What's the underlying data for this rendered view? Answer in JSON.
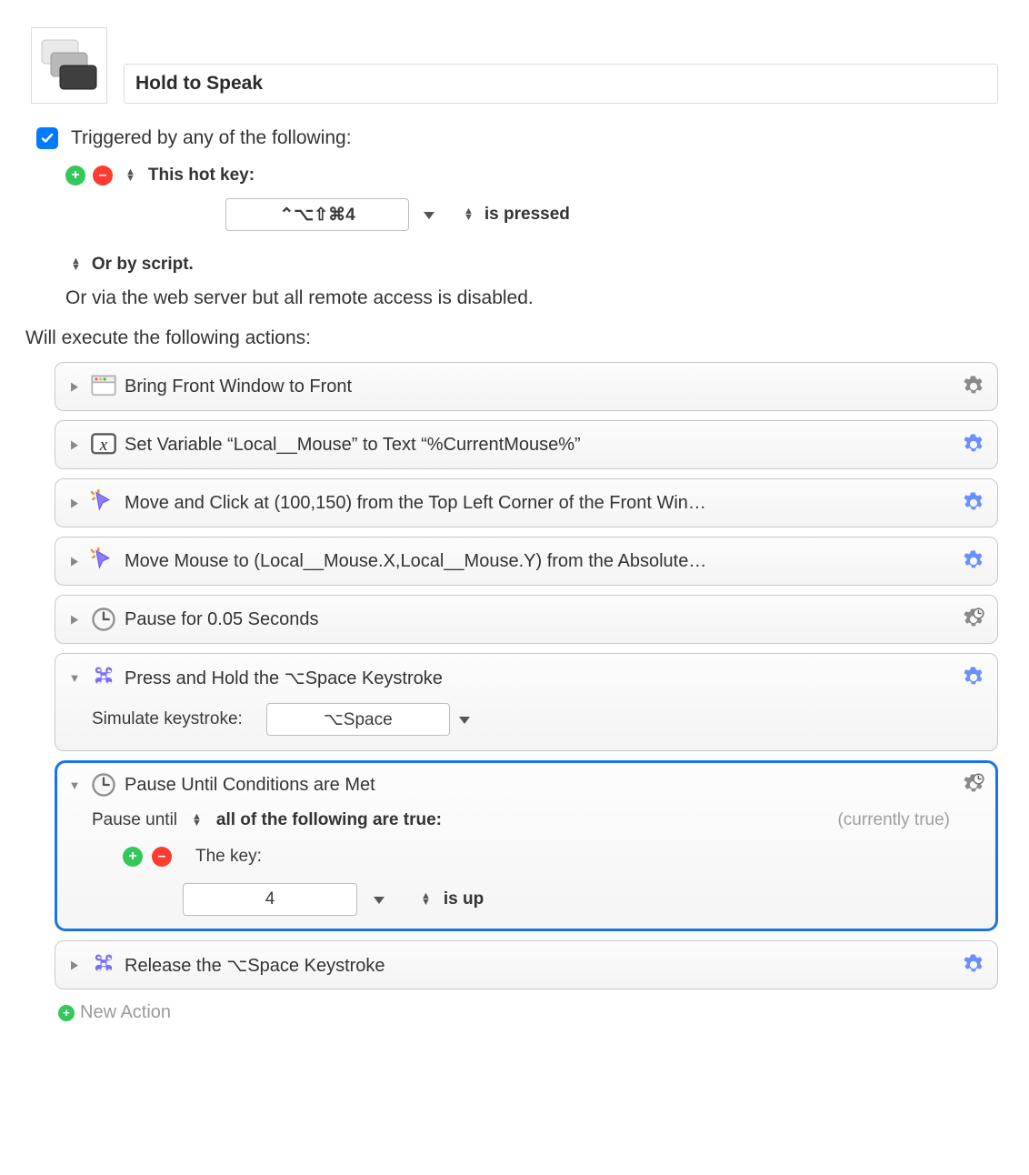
{
  "macro": {
    "name": "Hold to Speak"
  },
  "trigger": {
    "checkbox_checked": true,
    "label": "Triggered by any of the following:",
    "hotkey_label": "This hot key:",
    "hotkey_value": "⌃⌥⇧⌘4",
    "hotkey_state": "is pressed",
    "or_script_label": "Or by script.",
    "or_web_label": "Or via the web server but all remote access is disabled."
  },
  "actions_label": "Will execute the following actions:",
  "actions": [
    {
      "title": "Bring Front Window to Front"
    },
    {
      "title": "Set Variable “Local__Mouse” to Text “%CurrentMouse%”"
    },
    {
      "title": "Move and Click at (100,150) from the Top Left Corner of the Front Win…"
    },
    {
      "title": "Move Mouse to (Local__Mouse.X,Local__Mouse.Y) from the Absolute…"
    },
    {
      "title": "Pause for 0.05 Seconds"
    },
    {
      "title": "Press and Hold the ⌥Space Keystroke",
      "body": {
        "label": "Simulate keystroke:",
        "value": "⌥Space"
      }
    },
    {
      "title": "Pause Until Conditions are Met",
      "selected": true,
      "body": {
        "pause_label": "Pause until",
        "match_label": "all of the following are true:",
        "status": "(currently true)",
        "cond_label": "The key:",
        "cond_value": "4",
        "cond_state": "is up"
      }
    },
    {
      "title": "Release the ⌥Space Keystroke"
    }
  ],
  "footer": {
    "new_action": "New Action"
  }
}
